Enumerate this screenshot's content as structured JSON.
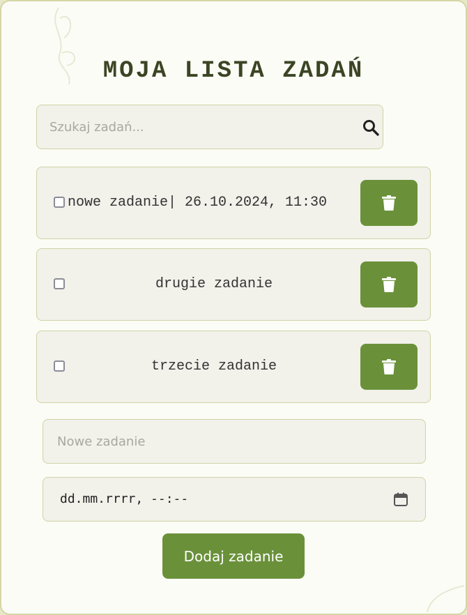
{
  "header": {
    "title": "MOJA LISTA ZADAŃ"
  },
  "search": {
    "placeholder": "Szukaj zadań...",
    "value": "",
    "icon": "search-icon"
  },
  "tasks": [
    {
      "text": "nowe zadanie| 26.10.2024, 11:30",
      "checked": false,
      "delete_icon": "trash-icon"
    },
    {
      "text": "drugie zadanie",
      "checked": false,
      "delete_icon": "trash-icon"
    },
    {
      "text": "trzecie zadanie",
      "checked": false,
      "delete_icon": "trash-icon"
    }
  ],
  "new_task": {
    "placeholder": "Nowe zadanie",
    "value": ""
  },
  "datetime": {
    "display": "dd.mm.rrrr, --:--",
    "icon": "calendar-icon"
  },
  "add_button": {
    "label": "Dodaj zadanie"
  },
  "colors": {
    "accent": "#6a913a",
    "title": "#3b4525",
    "field_bg": "#f2f1ea",
    "border": "#cfd3a6",
    "card_bg": "#fcfcf6"
  }
}
